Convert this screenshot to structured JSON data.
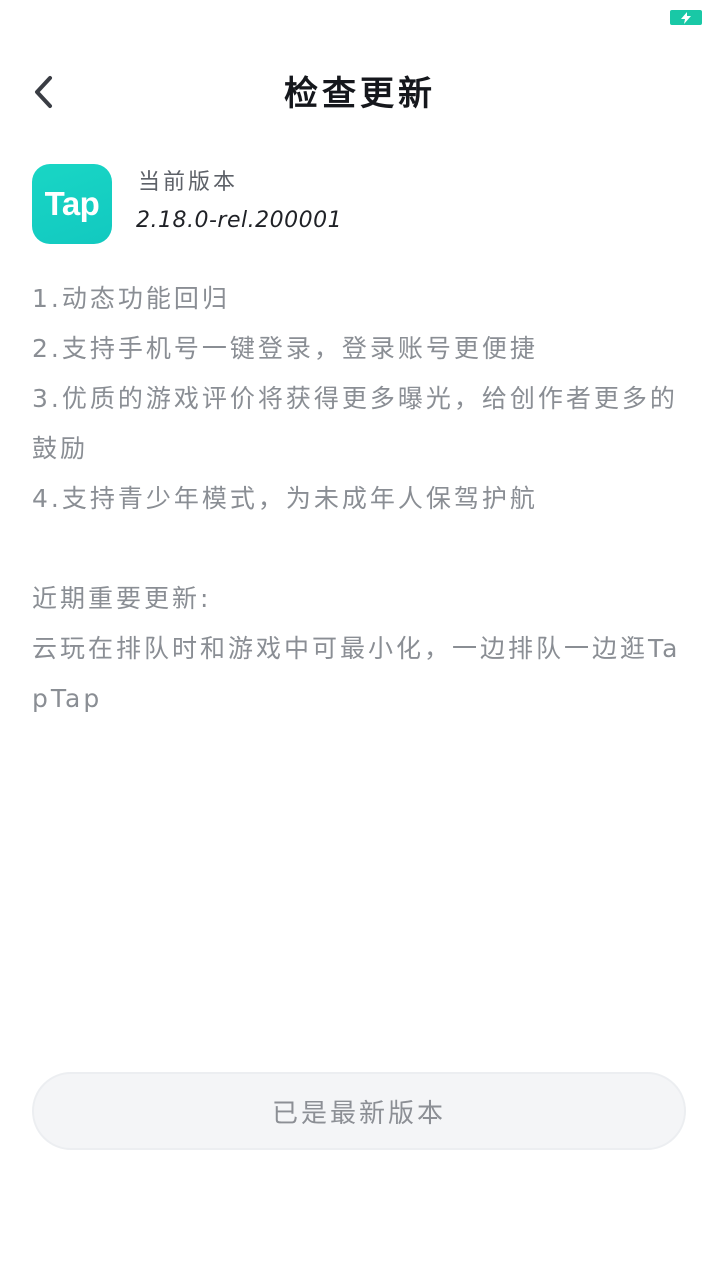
{
  "status_bar": {
    "battery_icon": "battery-charging-icon",
    "battery_color": "#19c8a6"
  },
  "header": {
    "back_icon": "chevron-left-icon",
    "title": "检查更新"
  },
  "app": {
    "logo_text": "Tap",
    "logo_color": "#15cfc3",
    "version_label": "当前版本",
    "version_value": "2.18.0-rel.200001"
  },
  "notes": {
    "items": [
      "1.动态功能回归",
      "2.支持手机号一键登录，登录账号更便捷",
      "3.优质的游戏评价将获得更多曝光，给创作者更多的鼓励",
      "4.支持青少年模式，为未成年人保驾护航"
    ],
    "recent_heading": "近期重要更新:",
    "recent_text": "云玩在排队时和游戏中可最小化，一边排队一边逛TapTap"
  },
  "footer": {
    "status_button_label": "已是最新版本"
  }
}
